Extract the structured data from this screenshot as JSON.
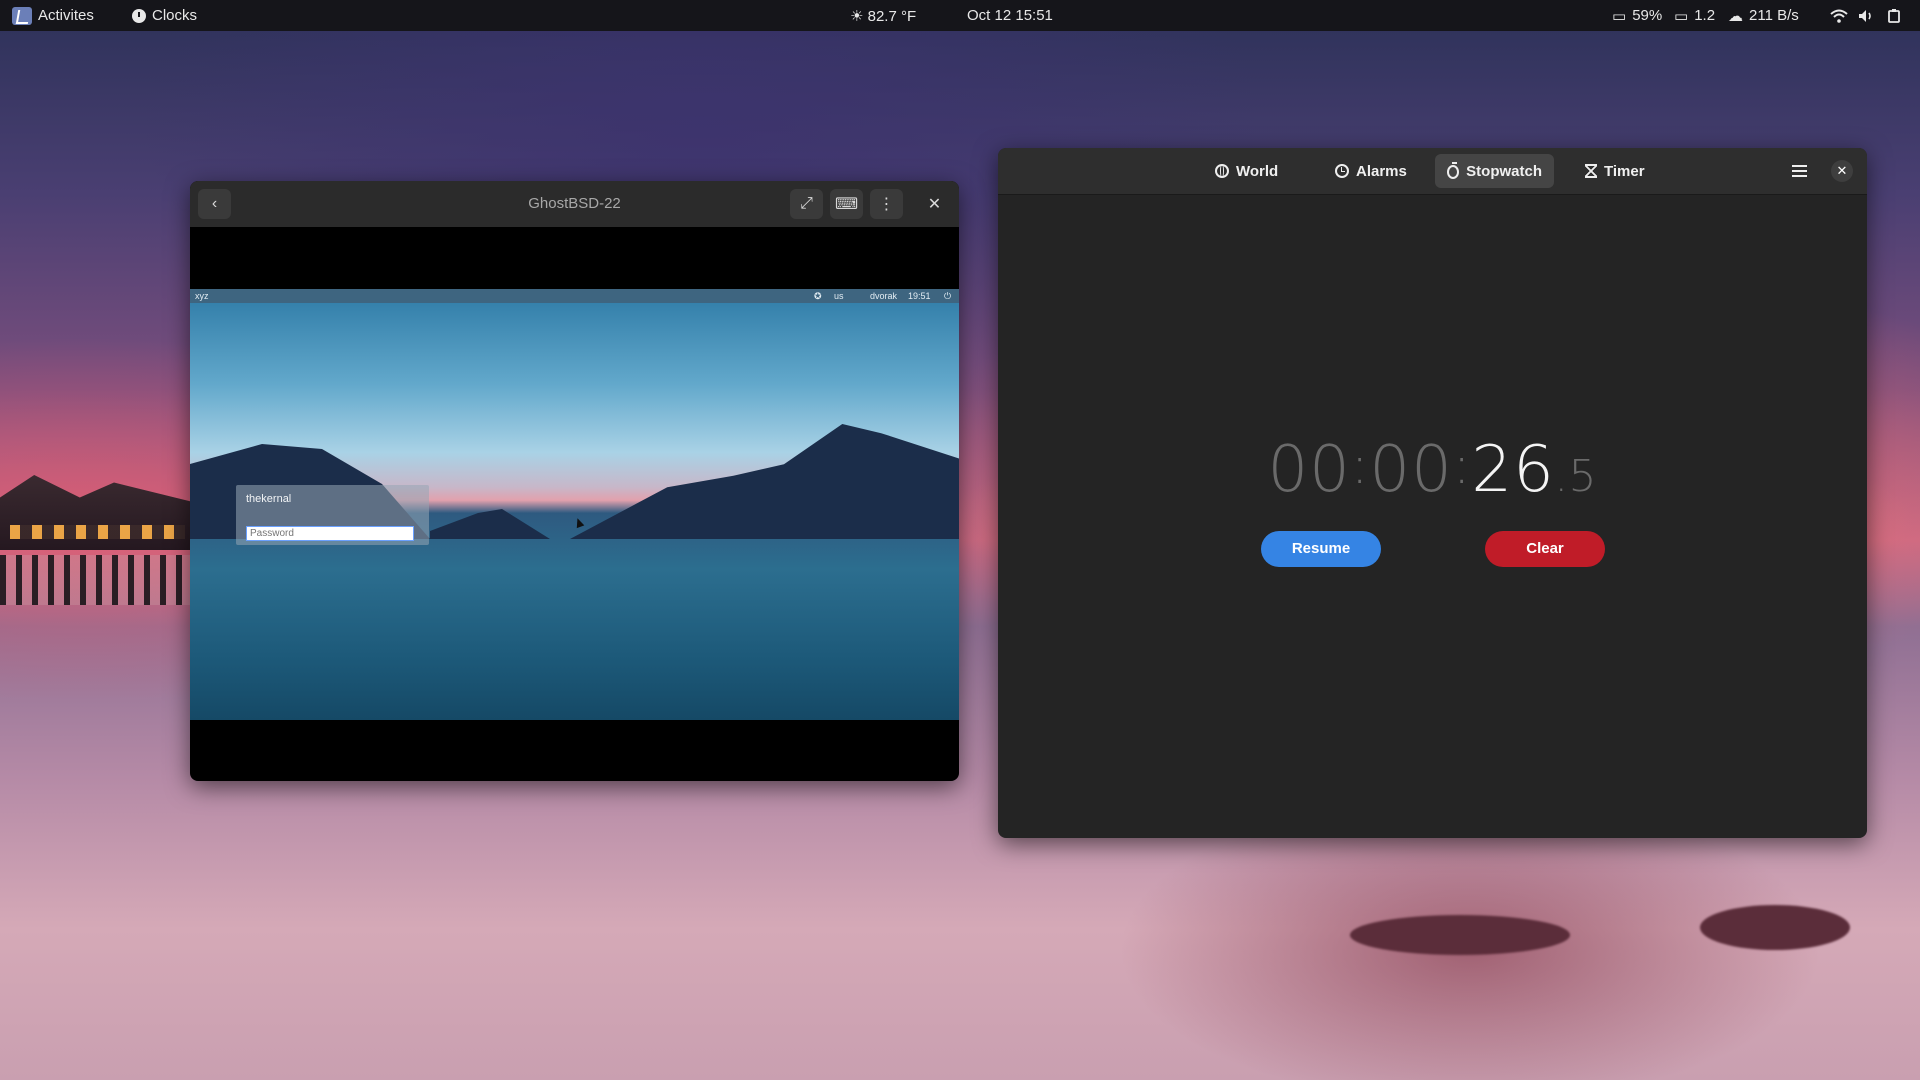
{
  "topbar": {
    "activities": "Activites",
    "app_name": "Clocks",
    "weather": "☀ 82.7 °F",
    "datetime": "Oct 12  15:51",
    "battery": "59%",
    "load": "1.2",
    "netspeed": "211 B/s"
  },
  "vm_window": {
    "title": "GhostBSD-22",
    "guest_panel": {
      "host": "xyz",
      "layout": "us",
      "keymap": "dvorak",
      "time": "19:51"
    },
    "login": {
      "username": "thekernal",
      "password_placeholder": "Password"
    }
  },
  "clocks_window": {
    "tabs": [
      {
        "label": "World",
        "icon": "globe-icon",
        "active": false
      },
      {
        "label": "Alarms",
        "icon": "alarm-icon",
        "active": false
      },
      {
        "label": "Stopwatch",
        "icon": "stopwatch-icon",
        "active": true
      },
      {
        "label": "Timer",
        "icon": "hourglass-icon",
        "active": false
      }
    ],
    "stopwatch": {
      "hours": "00",
      "minutes": "00",
      "seconds": "26",
      "tenths": "5"
    },
    "buttons": {
      "resume": "Resume",
      "clear": "Clear"
    },
    "colors": {
      "accent_blue": "#3584e4",
      "destructive_red": "#c01c28"
    }
  }
}
